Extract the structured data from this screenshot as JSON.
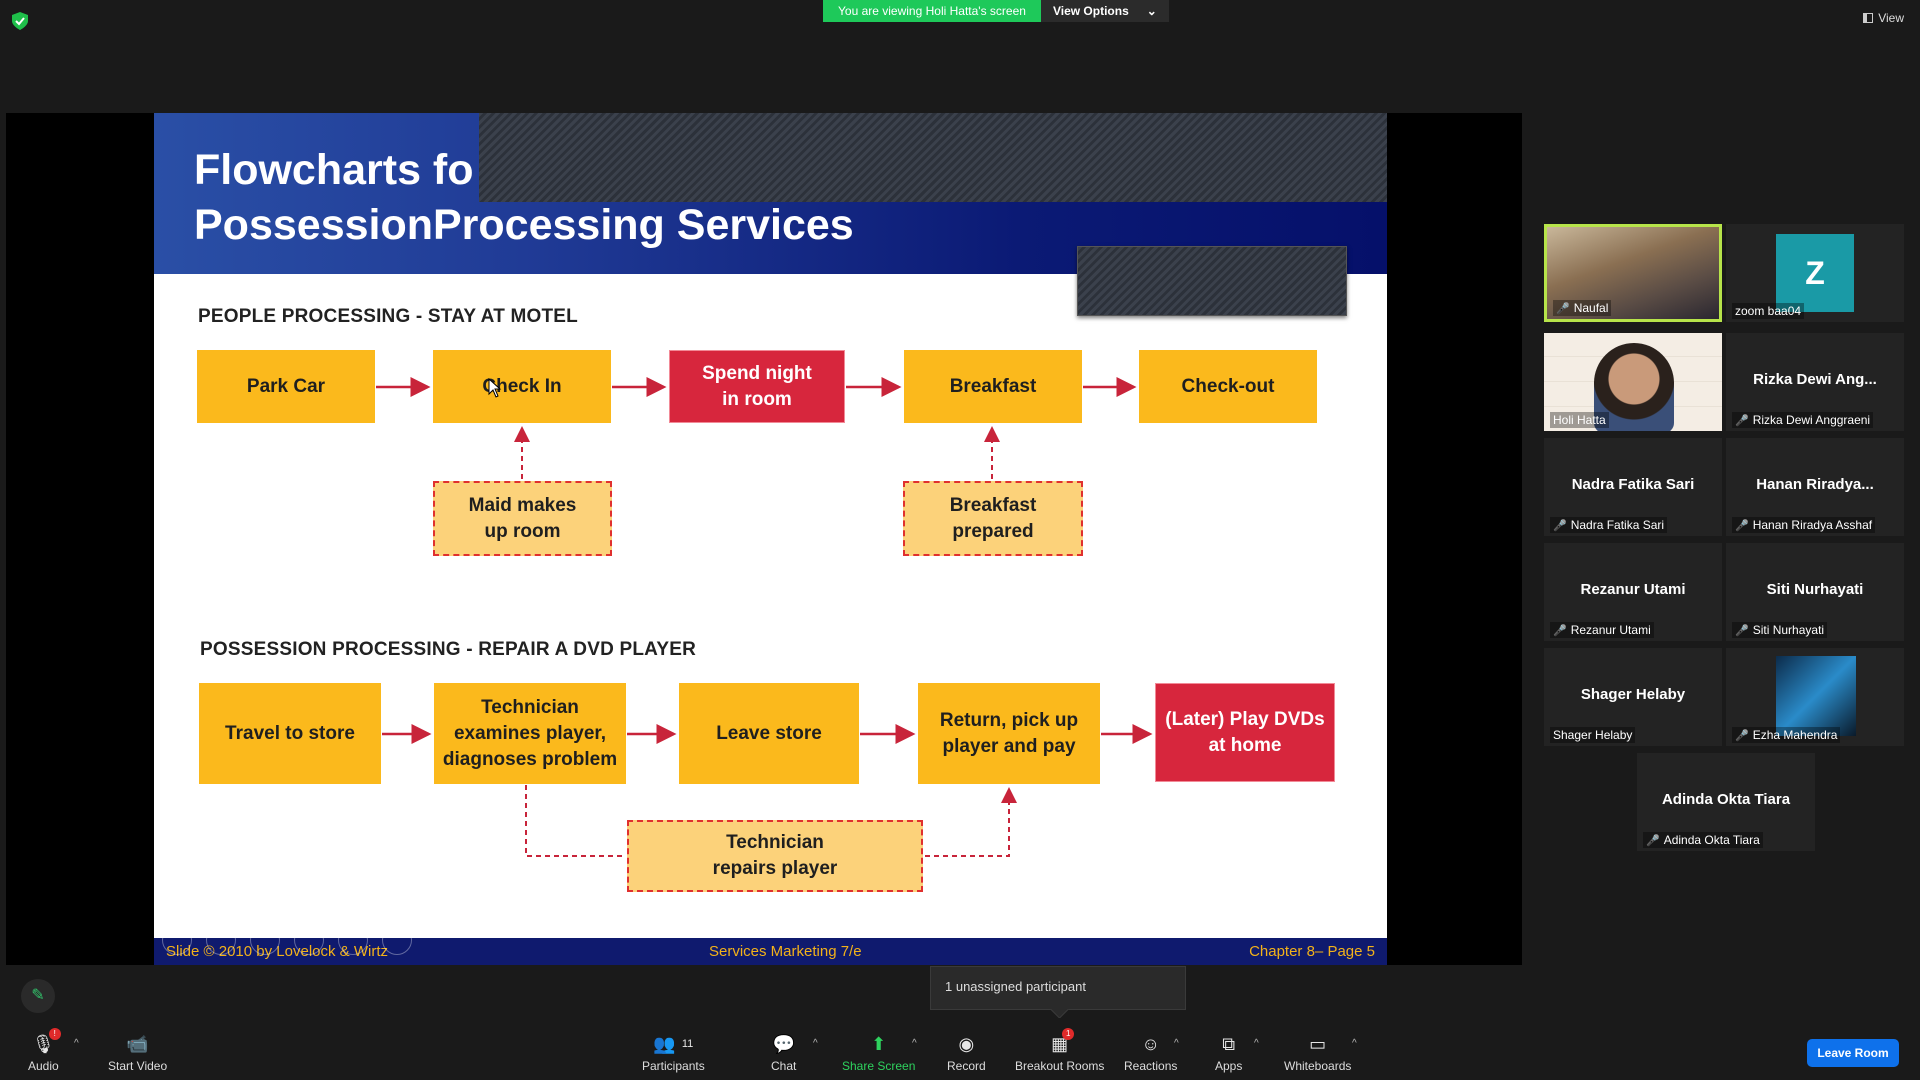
{
  "banner": {
    "viewing_text": "You are viewing Holi Hatta's screen",
    "view_options": "View Options"
  },
  "top_right": {
    "view_label": "View"
  },
  "slide": {
    "title_line1": "Flowcharts fo",
    "title_line2": "PossessionProcessing Services",
    "people": {
      "heading": "PEOPLE PROCESSING - STAY AT MOTEL",
      "steps": [
        "Park Car",
        "Check In",
        "Spend night in room",
        "Breakfast",
        "Check-out"
      ],
      "support": [
        "Maid makes up room",
        "Breakfast prepared"
      ]
    },
    "possession": {
      "heading": "POSSESSION PROCESSING - REPAIR A DVD PLAYER",
      "steps": [
        "Travel to store",
        "Technician examines player, diagnoses problem",
        "Leave store",
        "Return, pick up player and pay",
        "(Later) Play DVDs at home"
      ],
      "support": [
        "Technician repairs player"
      ]
    },
    "footer_left": "Slide © 2010 by Lovelock & Wirtz",
    "footer_center": "Services Marketing 7/e",
    "footer_right": "Chapter 8– Page 5"
  },
  "gallery": [
    {
      "name": "Naufal",
      "label": "Naufal",
      "type": "video",
      "muted": true,
      "active": true
    },
    {
      "name": "zoom baa04",
      "label": "zoom baa04",
      "type": "avatar",
      "initial": "Z",
      "muted": false
    },
    {
      "name": "Holi Hatta",
      "label": "Holi Hatta",
      "type": "video",
      "muted": false
    },
    {
      "name": "Rizka Dewi Ang...",
      "label": "Rizka Dewi Anggraeni",
      "type": "name",
      "muted": true
    },
    {
      "name": "Nadra Fatika Sari",
      "label": "Nadra Fatika Sari",
      "type": "name",
      "muted": true
    },
    {
      "name": "Hanan Riradya...",
      "label": "Hanan Riradya Asshaf",
      "type": "name",
      "muted": true
    },
    {
      "name": "Rezanur Utami",
      "label": "Rezanur Utami",
      "type": "name",
      "muted": true
    },
    {
      "name": "Siti Nurhayati",
      "label": "Siti Nurhayati",
      "type": "name",
      "muted": true
    },
    {
      "name": "Shager Helaby",
      "label": "Shager Helaby",
      "type": "name",
      "muted": false
    },
    {
      "name": "Ezha Mahendra",
      "label": "Ezha Mahendra",
      "type": "picture",
      "muted": true
    },
    {
      "name": "Adinda Okta Tiara",
      "label": "Adinda Okta Tiara",
      "type": "name",
      "muted": true
    }
  ],
  "notice": "1 unassigned participant",
  "toolbar": {
    "audio": "Audio",
    "start_video": "Start Video",
    "participants": "Participants",
    "participants_count": "11",
    "chat": "Chat",
    "share_screen": "Share Screen",
    "record": "Record",
    "breakout_rooms": "Breakout Rooms",
    "breakout_badge": "1",
    "audio_badge": "!",
    "reactions": "Reactions",
    "apps": "Apps",
    "whiteboards": "Whiteboards",
    "leave": "Leave Room"
  },
  "colors": {
    "accent_green": "#23d959",
    "leave_blue": "#0e71eb",
    "box_yellow": "#fbb91c",
    "box_red": "#d7263d"
  }
}
